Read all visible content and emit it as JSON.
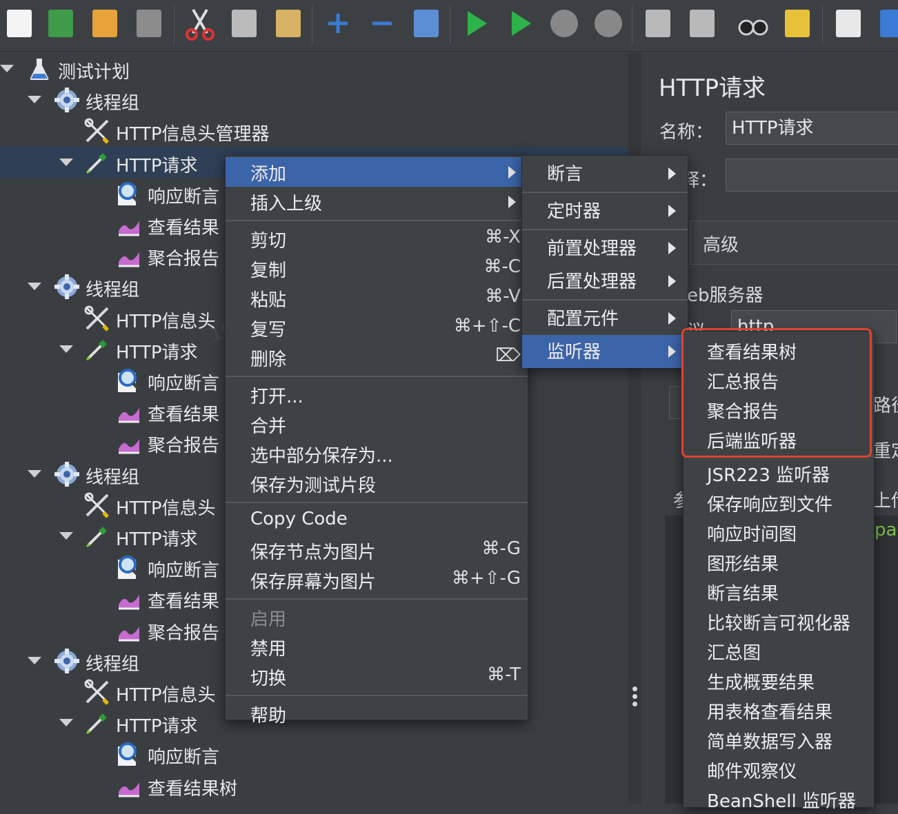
{
  "tree": {
    "items": [
      {
        "label": "测试计划",
        "icon": "flask-icon",
        "indent": 0,
        "expander": true,
        "selected": false
      },
      {
        "label": "线程组",
        "icon": "gear-icon",
        "indent": 1,
        "expander": true,
        "selected": false
      },
      {
        "label": "HTTP信息头管理器",
        "icon": "wrench-tools-icon",
        "indent": 2,
        "expander": false,
        "selected": false
      },
      {
        "label": "HTTP请求",
        "icon": "pipette-icon",
        "indent": 2,
        "expander": true,
        "selected": true
      },
      {
        "label": "响应断言",
        "icon": "magnifier-icon",
        "indent": 3,
        "expander": false,
        "selected": false
      },
      {
        "label": "查看结果",
        "icon": "chart-icon",
        "indent": 3,
        "expander": false,
        "selected": false
      },
      {
        "label": "聚合报告",
        "icon": "chart-icon",
        "indent": 3,
        "expander": false,
        "selected": false
      },
      {
        "label": "线程组",
        "icon": "gear-icon",
        "indent": 1,
        "expander": true,
        "selected": false
      },
      {
        "label": "HTTP信息头",
        "icon": "wrench-tools-icon",
        "indent": 2,
        "expander": false,
        "selected": false
      },
      {
        "label": "HTTP请求",
        "icon": "pipette-icon",
        "indent": 2,
        "expander": true,
        "selected": false
      },
      {
        "label": "响应断言",
        "icon": "magnifier-icon",
        "indent": 3,
        "expander": false,
        "selected": false
      },
      {
        "label": "查看结果",
        "icon": "chart-icon",
        "indent": 3,
        "expander": false,
        "selected": false
      },
      {
        "label": "聚合报告",
        "icon": "chart-icon",
        "indent": 3,
        "expander": false,
        "selected": false
      },
      {
        "label": "线程组",
        "icon": "gear-icon",
        "indent": 1,
        "expander": true,
        "selected": false
      },
      {
        "label": "HTTP信息头",
        "icon": "wrench-tools-icon",
        "indent": 2,
        "expander": false,
        "selected": false
      },
      {
        "label": "HTTP请求",
        "icon": "pipette-icon",
        "indent": 2,
        "expander": true,
        "selected": false
      },
      {
        "label": "响应断言",
        "icon": "magnifier-icon",
        "indent": 3,
        "expander": false,
        "selected": false
      },
      {
        "label": "查看结果",
        "icon": "chart-icon",
        "indent": 3,
        "expander": false,
        "selected": false
      },
      {
        "label": "聚合报告",
        "icon": "chart-icon",
        "indent": 3,
        "expander": false,
        "selected": false
      },
      {
        "label": "线程组",
        "icon": "gear-icon",
        "indent": 1,
        "expander": true,
        "selected": false
      },
      {
        "label": "HTTP信息头",
        "icon": "wrench-tools-icon",
        "indent": 2,
        "expander": false,
        "selected": false
      },
      {
        "label": "HTTP请求",
        "icon": "pipette-icon",
        "indent": 2,
        "expander": true,
        "selected": false
      },
      {
        "label": "响应断言",
        "icon": "magnifier-icon",
        "indent": 3,
        "expander": false,
        "selected": false
      },
      {
        "label": "查看结果树",
        "icon": "chart-icon",
        "indent": 3,
        "expander": false,
        "selected": false
      }
    ]
  },
  "panel": {
    "title": "HTTP请求",
    "name_label": "名称：",
    "name_value": "HTTP请求",
    "comment_label": "释：",
    "advanced_tab": "高级",
    "web_server_label": "eb服务器",
    "protocol_label": "议",
    "protocol_value": "http",
    "path_label": "路径",
    "redirect_label": "重定",
    "upload_label": "上传",
    "param_label": "参",
    "body_snippet": "pag"
  },
  "context_menu": {
    "items": [
      {
        "label": "添加",
        "shortcut": "",
        "submenu": true,
        "active": true
      },
      {
        "label": "插入上级",
        "shortcut": "",
        "submenu": true
      },
      {
        "sep": true
      },
      {
        "label": "剪切",
        "shortcut": "⌘-X"
      },
      {
        "label": "复制",
        "shortcut": "⌘-C"
      },
      {
        "label": "粘贴",
        "shortcut": "⌘-V"
      },
      {
        "label": "复写",
        "shortcut": "⌘+⇧-C"
      },
      {
        "label": "删除",
        "shortcut": "⌦"
      },
      {
        "sep": true
      },
      {
        "label": "打开..."
      },
      {
        "label": "合并"
      },
      {
        "label": "选中部分保存为..."
      },
      {
        "label": "保存为测试片段"
      },
      {
        "sep": true
      },
      {
        "label": "Copy Code"
      },
      {
        "label": "保存节点为图片",
        "shortcut": "⌘-G"
      },
      {
        "label": "保存屏幕为图片",
        "shortcut": "⌘+⇧-G"
      },
      {
        "sep": true
      },
      {
        "label": "启用",
        "disabled": true
      },
      {
        "label": "禁用"
      },
      {
        "label": "切换",
        "shortcut": "⌘-T"
      },
      {
        "sep": true
      },
      {
        "label": "帮助"
      }
    ]
  },
  "add_submenu": {
    "items": [
      {
        "label": "断言",
        "submenu": true
      },
      {
        "sep": true
      },
      {
        "label": "定时器",
        "submenu": true
      },
      {
        "sep": true
      },
      {
        "label": "前置处理器",
        "submenu": true
      },
      {
        "label": "后置处理器",
        "submenu": true
      },
      {
        "sep": true
      },
      {
        "label": "配置元件",
        "submenu": true
      },
      {
        "label": "监听器",
        "submenu": true,
        "active": true
      }
    ]
  },
  "listener_submenu": {
    "items": [
      {
        "label": "查看结果树"
      },
      {
        "label": "汇总报告"
      },
      {
        "label": "聚合报告"
      },
      {
        "label": "后端监听器"
      },
      {
        "sep": true
      },
      {
        "label": "JSR223 监听器"
      },
      {
        "label": "保存响应到文件"
      },
      {
        "label": "响应时间图"
      },
      {
        "label": "图形结果"
      },
      {
        "label": "断言结果"
      },
      {
        "label": "比较断言可视化器"
      },
      {
        "label": "汇总图"
      },
      {
        "label": "生成概要结果"
      },
      {
        "label": "用表格查看结果"
      },
      {
        "label": "简单数据写入器"
      },
      {
        "label": "邮件观察仪"
      },
      {
        "label": "BeanShell 监听器"
      }
    ]
  },
  "toolbar": {
    "buttons": [
      "new-file-icon",
      "templates-icon",
      "open-folder-icon",
      "save-icon",
      "cut-icon",
      "copy-icon",
      "paste-icon",
      "expand-plus-icon",
      "collapse-minus-icon",
      "toggle-icon",
      "start-icon",
      "start-no-pause-icon",
      "stop-icon",
      "shutdown-icon",
      "clear-icon",
      "clear-all-icon",
      "search-binoculars-icon",
      "reset-broom-icon",
      "function-helper-icon",
      "help-icon"
    ]
  },
  "colors": {
    "background": "#3b3e41",
    "selection": "#2f3f55",
    "menu_active": "#3c64a8",
    "highlight_box": "#e0432f"
  }
}
